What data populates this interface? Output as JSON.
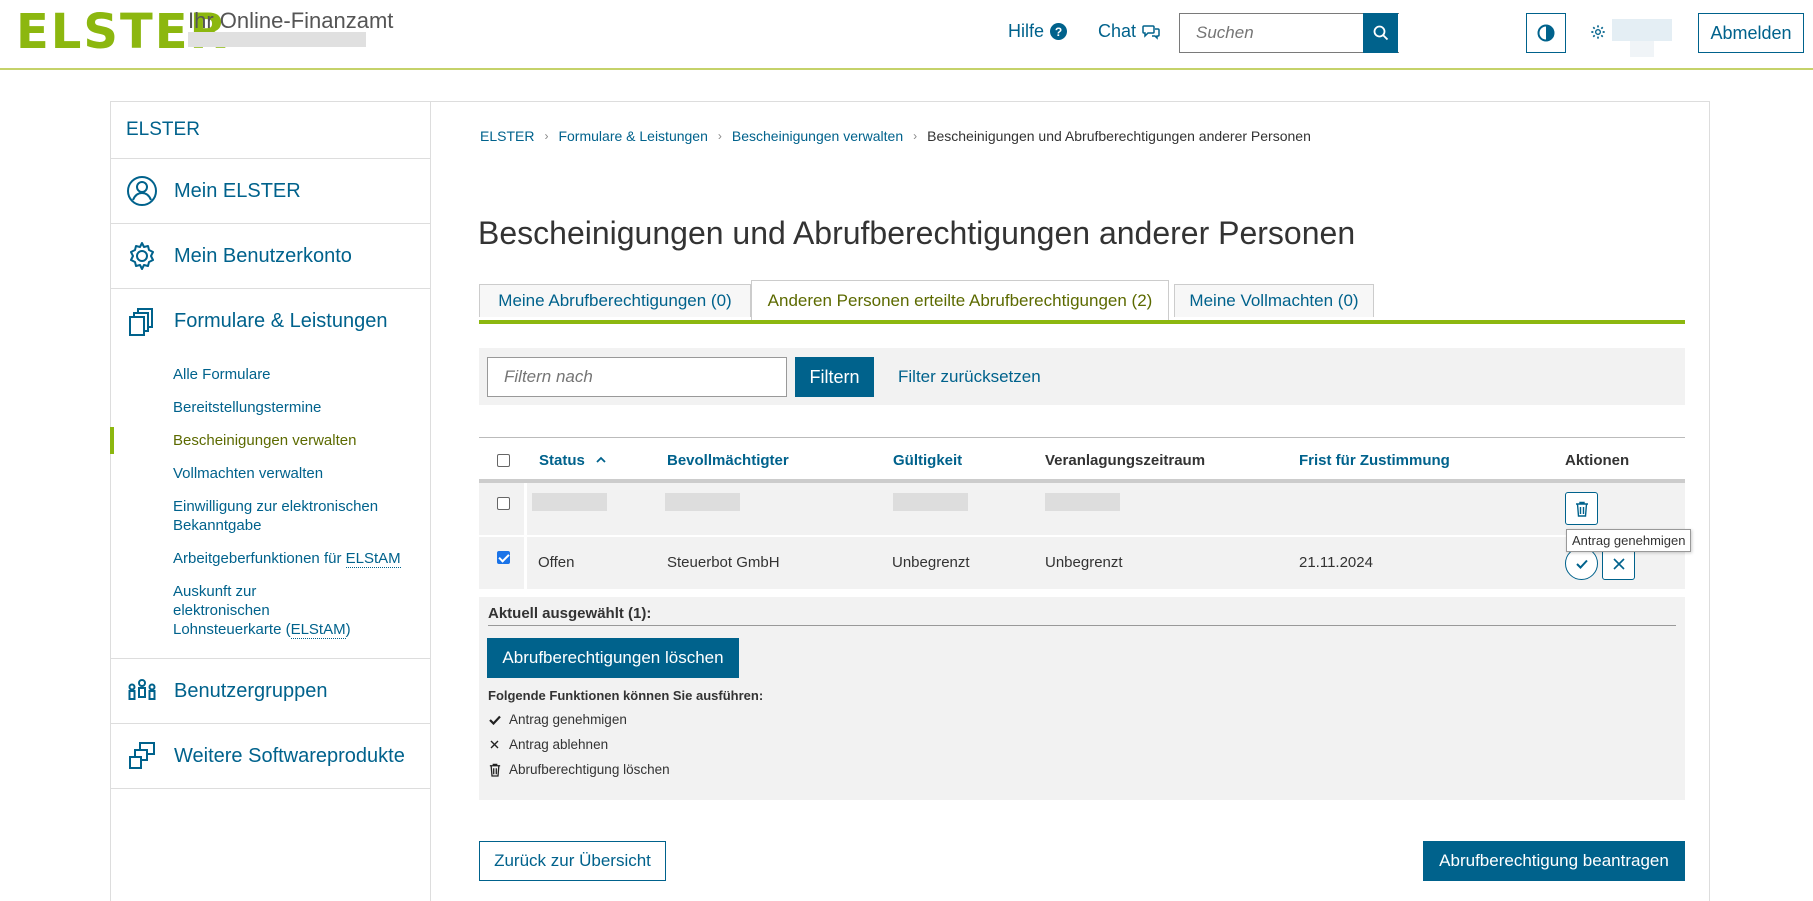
{
  "header": {
    "logo": "ELSTER",
    "tagline": "Ihr Online-Finanzamt",
    "help_label": "Hilfe",
    "chat_label": "Chat",
    "search_placeholder": "Suchen",
    "logout_label": "Abmelden"
  },
  "sidebar": {
    "top_label": "ELSTER",
    "items": {
      "mein_elster": "Mein ELSTER",
      "benutzerkonto": "Mein Benutzerkonto",
      "formulare": "Formulare & Leistungen",
      "benutzergruppen": "Benutzergruppen",
      "software": "Weitere Softwareprodukte"
    },
    "sub": {
      "alle_formulare": "Alle Formulare",
      "bereitstellung": "Bereitstellungstermine",
      "bescheinigungen": "Bescheinigungen verwalten",
      "vollmachten": "Vollmachten verwalten",
      "einwilligung": "Einwilligung zur elektronischen Bekanntgabe",
      "arbeitgeber_prefix": "Arbeitgeberfunktionen für ",
      "arbeitgeber_abbr": "ELStAM",
      "auskunft_prefix": "Auskunft zur elektronischen Lohnsteuerkarte (",
      "auskunft_abbr": "ELStAM",
      "auskunft_suffix": ")"
    }
  },
  "breadcrumb": {
    "b1": "ELSTER",
    "b2": "Formulare & Leistungen",
    "b3": "Bescheinigungen verwalten",
    "current": "Bescheinigungen und Abrufberechtigungen anderer Personen"
  },
  "page_title": "Bescheinigungen und Abrufberechtigungen anderer Personen",
  "tabs": {
    "t1": "Meine Abrufberechtigungen (0)",
    "t2": "Anderen Personen erteilte Abrufberechtigungen (2)",
    "t3": "Meine Vollmachten (0)"
  },
  "filter": {
    "placeholder": "Filtern nach",
    "button": "Filtern",
    "reset": "Filter zurücksetzen"
  },
  "table": {
    "columns": {
      "status": "Status",
      "bevollmaechtigter": "Bevollmächtigter",
      "gueltigkeit": "Gültigkeit",
      "zeitraum": "Veranlagungszeitraum",
      "frist": "Frist für Zustimmung",
      "aktionen": "Aktionen"
    },
    "row2": {
      "status": "Offen",
      "bevollmaechtigter": "Steuerbot GmbH",
      "gueltigkeit": "Unbegrenzt",
      "zeitraum": "Unbegrenzt",
      "frist": "21.11.2024"
    },
    "tooltip": "Antrag genehmigen"
  },
  "selection": {
    "title": "Aktuell ausgewählt (1):",
    "delete_button": "Abrufberechtigungen löschen",
    "functions_title": "Folgende Funktionen können Sie ausführen:",
    "f1": "Antrag genehmigen",
    "f2": "Antrag ablehnen",
    "f3": "Abrufberechtigung löschen"
  },
  "footer": {
    "back": "Zurück zur Übersicht",
    "apply": "Abrufberechtigung beantragen"
  }
}
